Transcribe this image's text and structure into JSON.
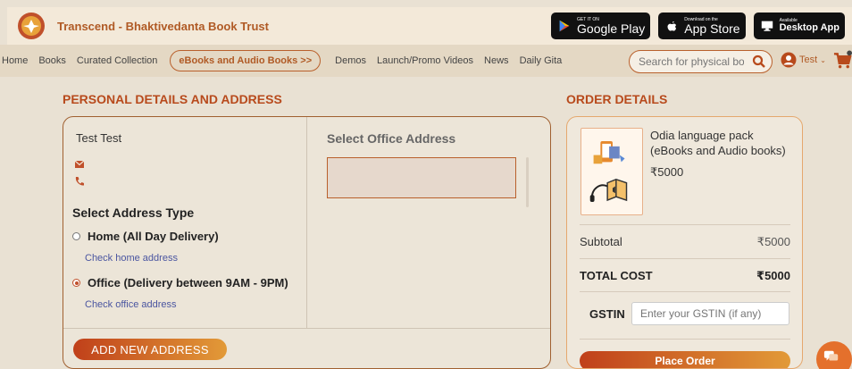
{
  "brand": {
    "name": "Transcend - Bhaktivedanta Book Trust"
  },
  "stores": [
    {
      "small": "GET IT ON",
      "big": "Google Play",
      "icon": "google-play-icon"
    },
    {
      "small": "Download on the",
      "big": "App Store",
      "icon": "apple-icon"
    },
    {
      "small": "Available",
      "big": "Desktop App",
      "icon": "desktop-icon"
    }
  ],
  "nav": {
    "items": [
      "Home",
      "Books",
      "Curated Collection"
    ],
    "pill": "eBooks and Audio Books >>",
    "items2": [
      "Demos",
      "Launch/Promo Videos",
      "News",
      "Daily Gita"
    ]
  },
  "search": {
    "placeholder": "Search for physical books"
  },
  "user": {
    "name": "Test"
  },
  "personal": {
    "title": "PERSONAL DETAILS AND ADDRESS",
    "name": "Test Test",
    "select_type": "Select Address Type",
    "home_option": "Home (All Day Delivery)",
    "home_link": "Check home address",
    "office_option": "Office (Delivery between 9AM - 9PM)",
    "office_link": "Check office address",
    "office_title": "Select Office Address",
    "add_button": "ADD NEW ADDRESS",
    "selected": "office"
  },
  "order": {
    "title": "ORDER DETAILS",
    "product_name": "Odia language pack (eBooks and Audio books)",
    "product_price": "₹5000",
    "subtotal_label": "Subtotal",
    "subtotal_value": "₹5000",
    "total_label": "TOTAL COST",
    "total_value": "₹5000",
    "gstin_label": "GSTIN",
    "gstin_placeholder": "Enter your GSTIN (if any)",
    "place_button": "Place Order"
  },
  "colors": {
    "accent": "#b84a1c",
    "button_start": "#c0401a",
    "button_end": "#e29a38"
  }
}
